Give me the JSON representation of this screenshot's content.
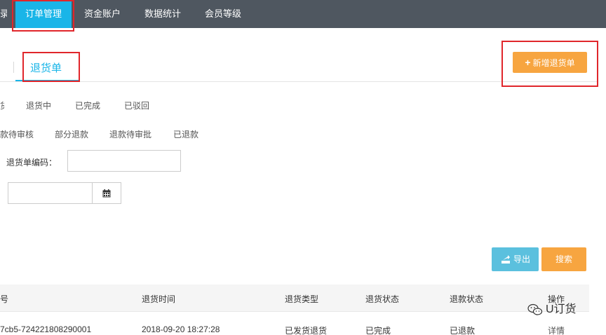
{
  "topnav": {
    "items": [
      {
        "label": "录"
      },
      {
        "label": "订单管理",
        "active": true
      },
      {
        "label": "资金账户"
      },
      {
        "label": "数据统计"
      },
      {
        "label": "会员等级"
      }
    ],
    "bg_color": "#4f5760",
    "active_color": "#19b5e8"
  },
  "tabs": {
    "active_label": "退货单"
  },
  "actions": {
    "add_return_label": "新增退货单",
    "add_icon": "plus-icon",
    "export_label": "导出",
    "export_icon": "export-icon",
    "search_label": "搜索"
  },
  "filters": {
    "status_row": [
      "货",
      "退货中",
      "已完成",
      "已驳回"
    ],
    "refund_row": [
      "款待审核",
      "部分退款",
      "退款待审批",
      "已退款"
    ]
  },
  "form": {
    "code_label": "退货单编码：",
    "code_value": "",
    "date_value": "",
    "calendar_icon": "calendar-icon"
  },
  "table": {
    "headers": [
      "号",
      "退货时间",
      "退货类型",
      "退货状态",
      "退款状态",
      "操作"
    ],
    "rows": [
      [
        "7cb5-724221808290001",
        "2018-09-20 18:27:28",
        "已发货退货",
        "已完成",
        "已退款",
        "详情"
      ]
    ]
  },
  "watermark": {
    "text": "U订货",
    "icon": "wechat-icon"
  },
  "colors": {
    "accent": "#19b5e8",
    "orange": "#f7a540",
    "export_blue": "#5bc0de",
    "highlight_red": "#e0262b"
  }
}
